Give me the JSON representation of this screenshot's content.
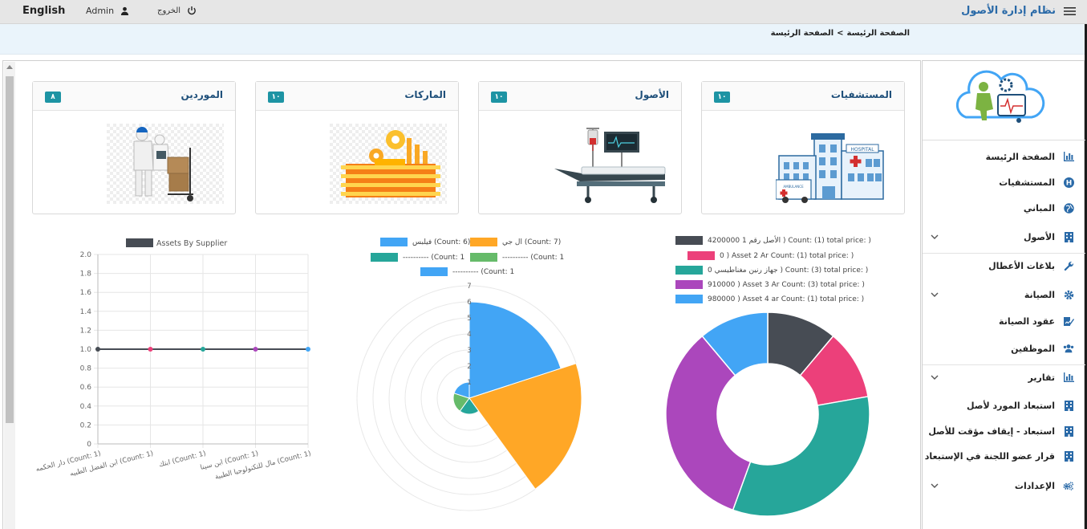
{
  "topbar": {
    "language": "English",
    "user": "Admin",
    "logout": "الخروج",
    "app_title": "نظام إدارة الأصول"
  },
  "breadcrumb": {
    "home": "الصفحة الرئيسة",
    "separator": ">",
    "current": "الصفحة الرئيسة"
  },
  "cards": [
    {
      "title": "المستشفيات",
      "count": "١٠",
      "icon": "hospital-icon"
    },
    {
      "title": "الأصول",
      "count": "١٠",
      "icon": "hospital-bed-icon"
    },
    {
      "title": "الماركات",
      "count": "١٠",
      "icon": "factory-icon"
    },
    {
      "title": "الموردين",
      "count": "٨",
      "icon": "delivery-worker-icon"
    }
  ],
  "sidebar": {
    "items": [
      {
        "label": "الصفحة الرئيسة",
        "icon": "bar-chart-icon",
        "expandable": false
      },
      {
        "label": "المستشفيات",
        "icon": "h-circle-icon",
        "expandable": false
      },
      {
        "label": "المباني",
        "icon": "globe-icon",
        "expandable": false
      },
      {
        "label": "الأصول",
        "icon": "building-icon",
        "expandable": true
      },
      {
        "label": "بلاغات الأعطال",
        "icon": "wrench-icon",
        "expandable": false
      },
      {
        "label": "الصيانة",
        "icon": "gear-icon",
        "expandable": true
      },
      {
        "label": "عقود الصيانة",
        "icon": "contract-icon",
        "expandable": false
      },
      {
        "label": "الموظفين",
        "icon": "users-icon",
        "expandable": false
      },
      {
        "label": "تقارير",
        "icon": "bar-chart-icon",
        "expandable": true
      },
      {
        "label": "استبعاد المورد لأصل",
        "icon": "building-icon",
        "expandable": false
      },
      {
        "label": "استبعاد - إيقاف مؤقت للأصل",
        "icon": "building-icon",
        "expandable": false
      },
      {
        "label": "قرار عضو اللجنة في الإستبعاد",
        "icon": "building-icon",
        "expandable": false
      },
      {
        "label": "الإعدادات",
        "icon": "gears-icon",
        "expandable": true
      }
    ]
  },
  "colors": {
    "accent": "#1d94a4",
    "brand": "#2a6aa8",
    "dark": "#474c54",
    "pink": "#ec407a",
    "teal": "#26a69a",
    "purple": "#ab47bc",
    "blue": "#42a5f5",
    "orange": "#ffa726",
    "green": "#66bb6a"
  },
  "chart_data": [
    {
      "type": "line",
      "legend": [
        "Assets By Supplier"
      ],
      "categories": [
        "دار الحكمه (Count: 1)",
        "ابن الفضل الطبيه (Count: 1)",
        "ابتك (Count: 1)",
        "ابن سينا (Count: 1)",
        "مال للتكنولوجيا الطبية (Count: 1)"
      ],
      "series": [
        {
          "name": "Assets By Supplier",
          "values": [
            1,
            1,
            1,
            1,
            1
          ]
        }
      ],
      "point_colors": [
        "#474c54",
        "#ec407a",
        "#26a69a",
        "#ab47bc",
        "#42a5f5"
      ],
      "ylim": [
        0,
        2
      ],
      "yticks": [
        "2.0",
        "1.8",
        "1.6",
        "1.4",
        "1.2",
        "1.0",
        "0.8",
        "0.6",
        "0.4",
        "0.2",
        "0"
      ],
      "grid": true
    },
    {
      "type": "polarArea",
      "legend": [
        {
          "label": "ال جي (Count: 7)",
          "color": "#ffa726"
        },
        {
          "label": "فيلبس (Count: 6)",
          "color": "#42a5f5"
        },
        {
          "label": "---------- (Count: 1",
          "color": "#66bb6a"
        },
        {
          "label": "---------- (Count: 1",
          "color": "#26a69a"
        },
        {
          "label": "---------- (Count: 1",
          "color": "#42a5f5"
        }
      ],
      "values": [
        6,
        7,
        1,
        1,
        1
      ],
      "slice_colors": [
        "#42a5f5",
        "#ffa726",
        "#26a69a",
        "#66bb6a",
        "#42a5f5"
      ],
      "rlim": [
        0,
        7
      ],
      "rticks": [
        "7",
        "6",
        "5",
        "4",
        "3",
        "2",
        "1"
      ]
    },
    {
      "type": "doughnut",
      "legend": [
        {
          "label": "الأصل رقم 1 4200000 ) Count: (1) total price: )",
          "color": "#474c54"
        },
        {
          "label": "0 ) Asset 2 Ar Count: (1) total price: )",
          "color": "#ec407a"
        },
        {
          "label": "جهاز رنين مغناطيسي 0 ) Count: (3) total price: )",
          "color": "#26a69a"
        },
        {
          "label": "910000 ) Asset 3 Ar Count: (3) total price: )",
          "color": "#ab47bc"
        },
        {
          "label": "980000 ) Asset 4 ar Count: (1) total price: )",
          "color": "#42a5f5"
        }
      ],
      "values": [
        1,
        1,
        3,
        3,
        1
      ],
      "slice_colors": [
        "#474c54",
        "#ec407a",
        "#26a69a",
        "#ab47bc",
        "#42a5f5"
      ]
    }
  ]
}
